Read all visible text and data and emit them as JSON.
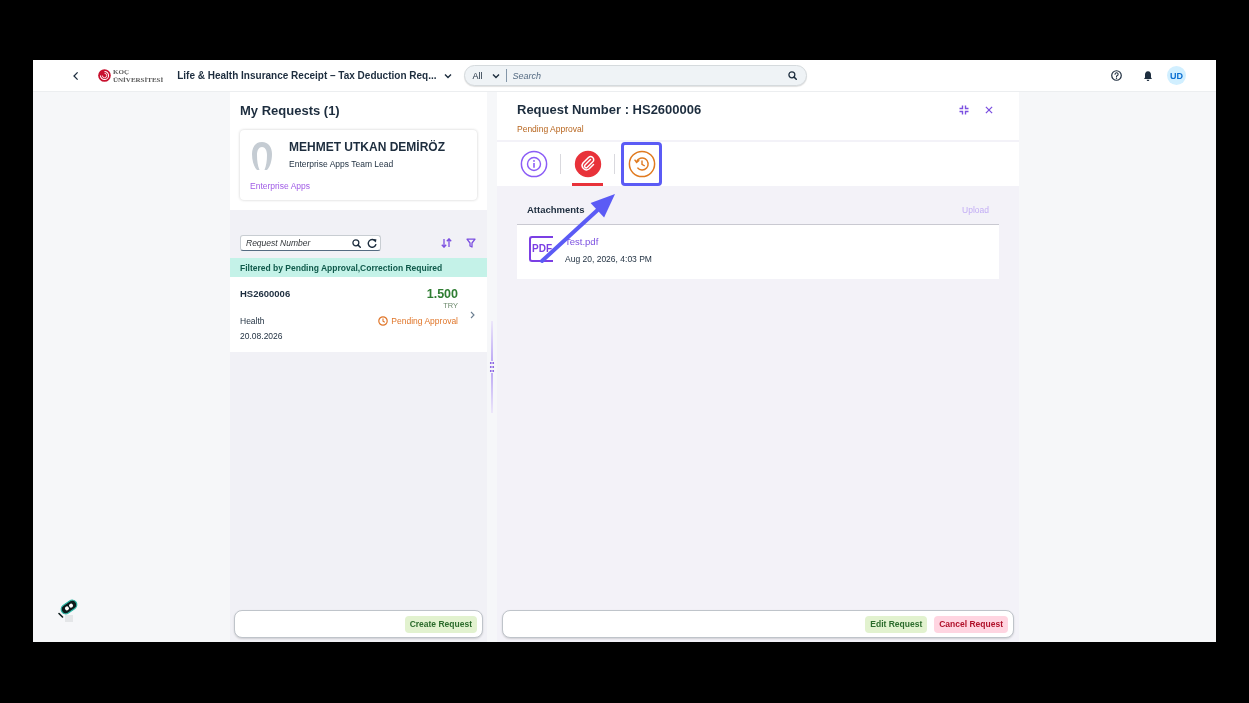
{
  "header": {
    "logo": {
      "line_1": "KOÇ",
      "line_2": "ÜNİVERSİTESİ"
    },
    "title": "Life & Health Insurance Receipt – Tax Deduction Req...",
    "search": {
      "scope": "All",
      "placeholder": "Search"
    },
    "avatar": "UD"
  },
  "list_panel": {
    "title": "My Requests (1)",
    "profile": {
      "name": "MEHMET UTKAN DEMİRÖZ",
      "role": "Enterprise Apps Team Lead",
      "department": "Enterprise Apps"
    },
    "search": {
      "placeholder": "Request Number"
    },
    "filter_info": "Filtered by Pending Approval,Correction Required",
    "requests": [
      {
        "number": "HS2600006",
        "amount": "1.500",
        "currency": "TRY",
        "type": "Health",
        "status": "Pending Approval",
        "date": "20.08.2026"
      }
    ],
    "buttons": [
      {
        "label": "Create Request",
        "kind": "positive"
      }
    ]
  },
  "detail": {
    "title": "Request Number : HS2600006",
    "status": "Pending Approval",
    "tabs": [
      {
        "kind": "info",
        "color": "#8b5cf6",
        "selected": false,
        "highlighted": false
      },
      {
        "kind": "attachments",
        "color": "#e8323a",
        "selected": true,
        "highlighted": false
      },
      {
        "kind": "history",
        "color": "#e07a1f",
        "selected": false,
        "highlighted": true
      }
    ],
    "attachments": {
      "title": "Attachments",
      "upload": {
        "label": "Upload",
        "disabled": true
      },
      "files": [
        {
          "type_label": "PDF",
          "name": "Test.pdf",
          "date": "Aug 20, 2026, 4:03 PM"
        }
      ]
    },
    "buttons": [
      {
        "label": "Edit Request",
        "kind": "positive"
      },
      {
        "label": "Cancel Request",
        "kind": "negative"
      }
    ]
  },
  "annotation": {
    "kind": "arrow"
  }
}
